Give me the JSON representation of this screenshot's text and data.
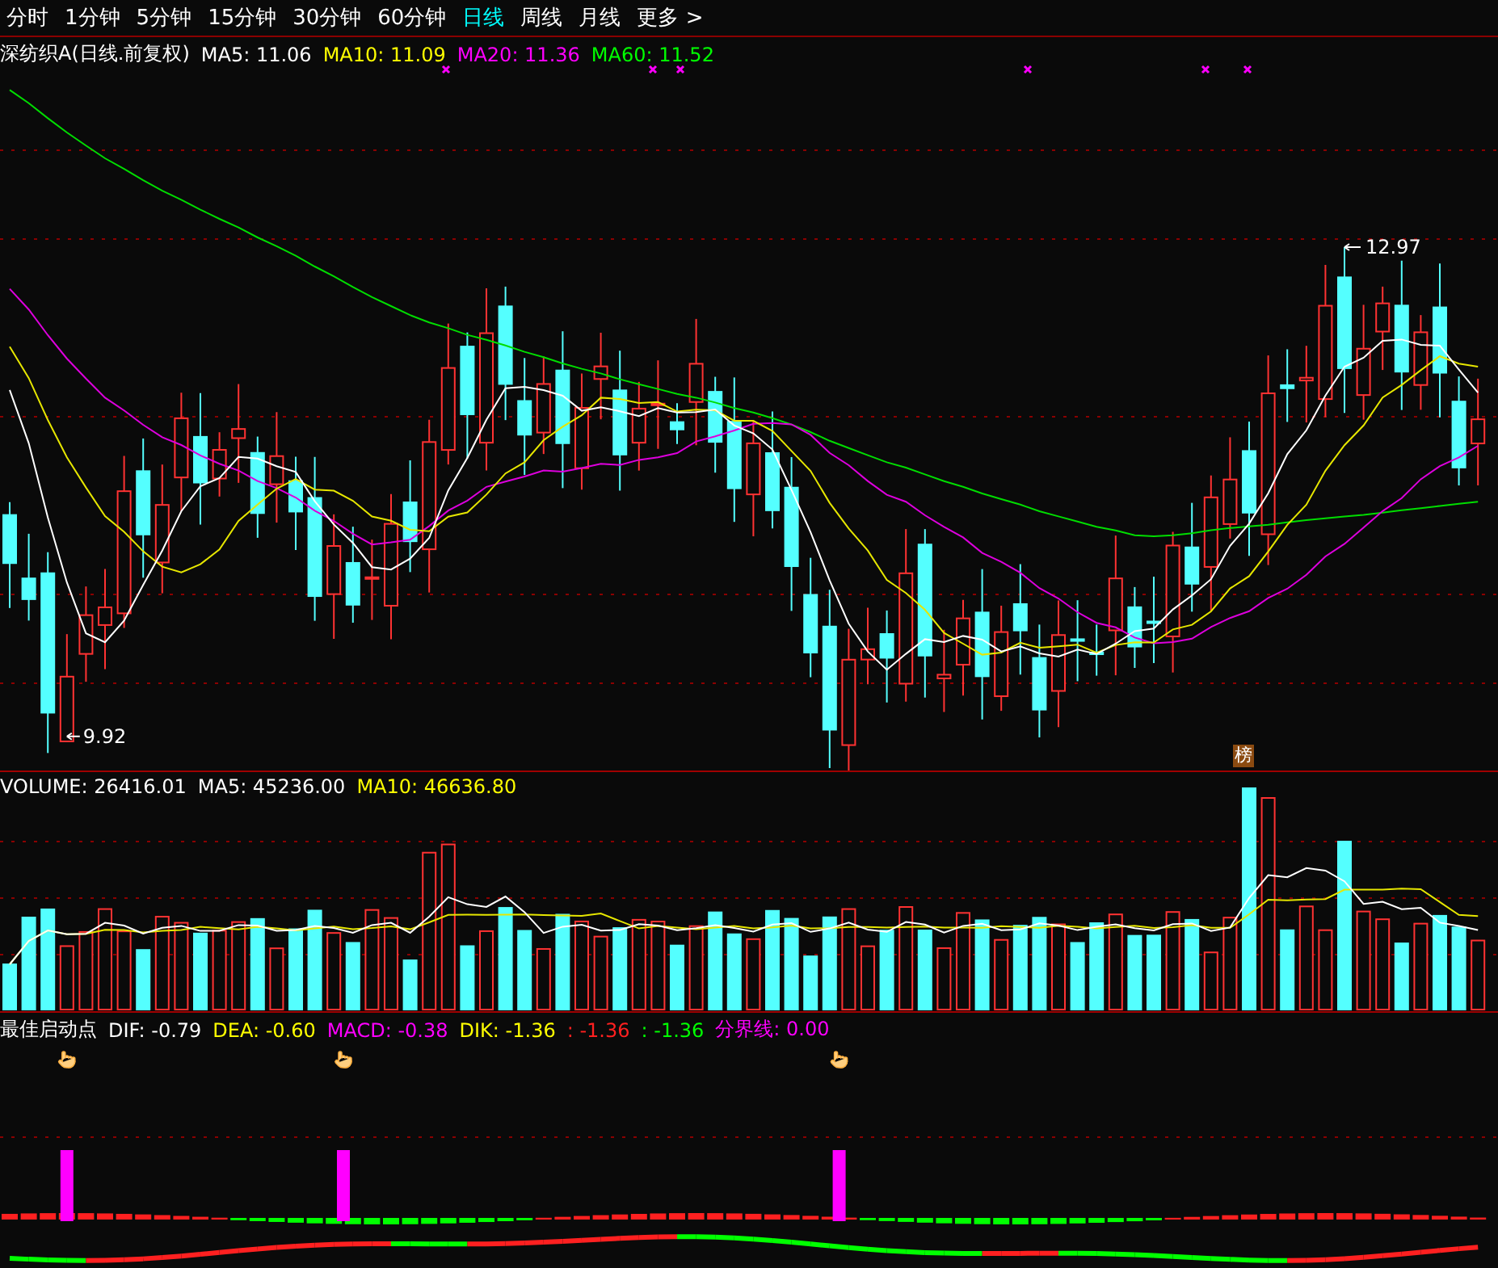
{
  "period_tabs": [
    {
      "label": "分时",
      "selected": false
    },
    {
      "label": "1分钟",
      "selected": false
    },
    {
      "label": "5分钟",
      "selected": false
    },
    {
      "label": "15分钟",
      "selected": false
    },
    {
      "label": "30分钟",
      "selected": false
    },
    {
      "label": "60分钟",
      "selected": false
    },
    {
      "label": "日线",
      "selected": true
    },
    {
      "label": "周线",
      "selected": false
    },
    {
      "label": "月线",
      "selected": false
    },
    {
      "label": "更多 >",
      "selected": false
    }
  ],
  "price_legend": {
    "title": "深纺织A(日线.前复权)",
    "items": [
      {
        "label": "MA5: 11.06",
        "color": "#ffffff"
      },
      {
        "label": "MA10: 11.09",
        "color": "#ffff00"
      },
      {
        "label": "MA20: 11.36",
        "color": "#ff00ff"
      },
      {
        "label": "MA60: 11.52",
        "color": "#00ff00"
      }
    ]
  },
  "price_chart": {
    "high_label": "12.97",
    "low_label": "9.92",
    "badge": "榜"
  },
  "volume_legend": {
    "items": [
      {
        "label": "VOLUME: 26416.01",
        "color": "#ffffff"
      },
      {
        "label": "MA5: 45236.00",
        "color": "#ffffff"
      },
      {
        "label": "MA10: 46636.80",
        "color": "#ffff00"
      }
    ]
  },
  "macd_legend": {
    "title": "最佳启动点",
    "items": [
      {
        "label": "DIF: -0.79",
        "color": "#ffffff"
      },
      {
        "label": "DEA: -0.60",
        "color": "#ffff00"
      },
      {
        "label": "MACD: -0.38",
        "color": "#ff00ff"
      },
      {
        "label": "DIK: -1.36",
        "color": "#ffff00"
      },
      {
        "label": ": -1.36",
        "color": "#ff2020"
      },
      {
        "label": ": -1.36",
        "color": "#00ff00"
      },
      {
        "label": "分界线: 0.00",
        "color": "#ff00ff"
      }
    ]
  }
}
